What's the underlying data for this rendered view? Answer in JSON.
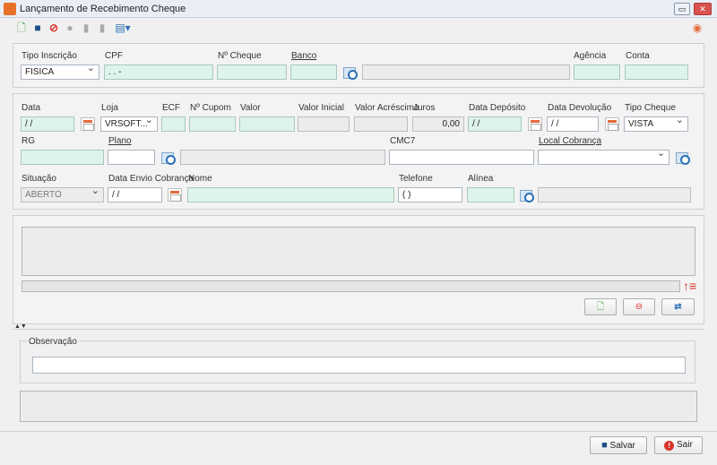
{
  "window": {
    "title": "Lançamento de Recebimento Cheque"
  },
  "icons": {
    "app": "app-icon",
    "new": "new-document-icon",
    "save": "save-icon",
    "cancel": "cancel-icon",
    "comment": "comment-icon",
    "copy": "copy-icon",
    "copy2": "copy-icon",
    "print": "print-icon",
    "info": "info-icon"
  },
  "row1": {
    "tipo_inscricao": {
      "label": "Tipo Inscrição",
      "value": "FISICA"
    },
    "cpf": {
      "label": "CPF",
      "value": ". . -"
    },
    "num_cheque": {
      "label": "Nº Cheque",
      "value": ""
    },
    "banco": {
      "label": "Banco",
      "value": ""
    },
    "agencia": {
      "label": "Agência",
      "value": ""
    },
    "conta": {
      "label": "Conta",
      "value": ""
    }
  },
  "row2": {
    "data": {
      "label": "Data",
      "value": "/ /"
    },
    "loja": {
      "label": "Loja",
      "value": "VRSOFT..."
    },
    "ecf": {
      "label": "ECF",
      "value": ""
    },
    "num_cupom": {
      "label": "Nº Cupom",
      "value": ""
    },
    "valor": {
      "label": "Valor",
      "value": ""
    },
    "valor_inicial": {
      "label": "Valor Inicial",
      "value": ""
    },
    "valor_acrescimo": {
      "label": "Valor Acréscimo",
      "value": ""
    },
    "juros": {
      "label": "Juros",
      "value": "0,00"
    },
    "data_deposito": {
      "label": "Data Depósito",
      "value": "/ /"
    },
    "data_devolucao": {
      "label": "Data Devolução",
      "value": "/ /"
    },
    "tipo_cheque": {
      "label": "Tipo Cheque",
      "value": "VISTA"
    }
  },
  "row3": {
    "rg": {
      "label": "RG",
      "value": ""
    },
    "plano": {
      "label": "Plano",
      "value": ""
    },
    "cmc7": {
      "label": "CMC7",
      "value": ""
    },
    "local_cobranca": {
      "label": "Local Cobrança",
      "value": ""
    }
  },
  "row4": {
    "situacao": {
      "label": "Situação",
      "value": "ABERTO"
    },
    "data_envio_cobranca": {
      "label": "Data Envio Cobrança",
      "value": "/ /"
    },
    "nome": {
      "label": "Nome",
      "value": ""
    },
    "telefone": {
      "label": "Telefone",
      "value": "( )"
    },
    "alinea": {
      "label": "Alínea",
      "value": ""
    }
  },
  "observacao": {
    "label": "Observação",
    "value": ""
  },
  "footer": {
    "salvar": "Salvar",
    "sair": "Sair"
  },
  "colors": {
    "accent": "#e8712a",
    "field_green": "#def3ea",
    "danger": "#d9534f"
  }
}
